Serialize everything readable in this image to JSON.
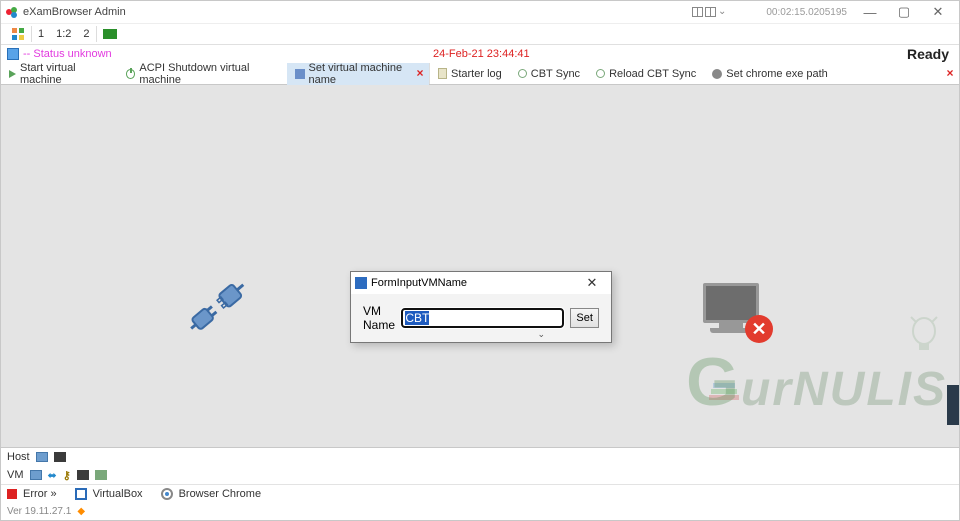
{
  "titlebar": {
    "app_title": "eXamBrowser Admin",
    "clock": "00:02:15.0205195"
  },
  "quickbar": {
    "btn1": "1",
    "btn2": "1:2",
    "btn3": "2"
  },
  "status_line": {
    "text": "-- Status unknown",
    "timestamp": "24-Feb-21 23:44:41",
    "ready": "Ready"
  },
  "toolbar_left": {
    "start_vm": "Start virtual machine",
    "acpi_shutdown": "ACPI Shutdown virtual machine",
    "set_vm_name": "Set virtual machine name"
  },
  "toolbar_right": {
    "starter_log": "Starter log",
    "cbt_sync": "CBT Sync",
    "reload_cbt": "Reload CBT Sync",
    "set_chrome": "Set chrome exe path"
  },
  "dialog": {
    "title": "FormInputVMName",
    "label": "VM Name",
    "value": "CBT",
    "set_btn": "Set"
  },
  "bottom": {
    "host_label": "Host",
    "vm_label": "VM",
    "error_label": "Error »",
    "virtualbox": "VirtualBox",
    "browser_chrome": "Browser Chrome",
    "footer_line": "Ver 19.11.27.1"
  },
  "watermark": {
    "text1": "G",
    "text2": "urNULIS"
  }
}
